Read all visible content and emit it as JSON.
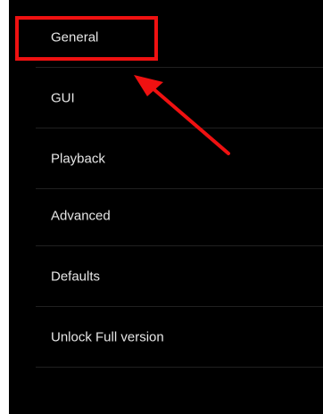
{
  "settings_menu": {
    "items": [
      {
        "label": "General"
      },
      {
        "label": "GUI"
      },
      {
        "label": "Playback"
      },
      {
        "label": "Advanced"
      },
      {
        "label": "Defaults"
      },
      {
        "label": "Unlock Full version"
      }
    ]
  },
  "annotation": {
    "highlight_color": "#ef1111",
    "highlighted_item": "General",
    "arrow_icon": "arrow-up-left-icon"
  }
}
